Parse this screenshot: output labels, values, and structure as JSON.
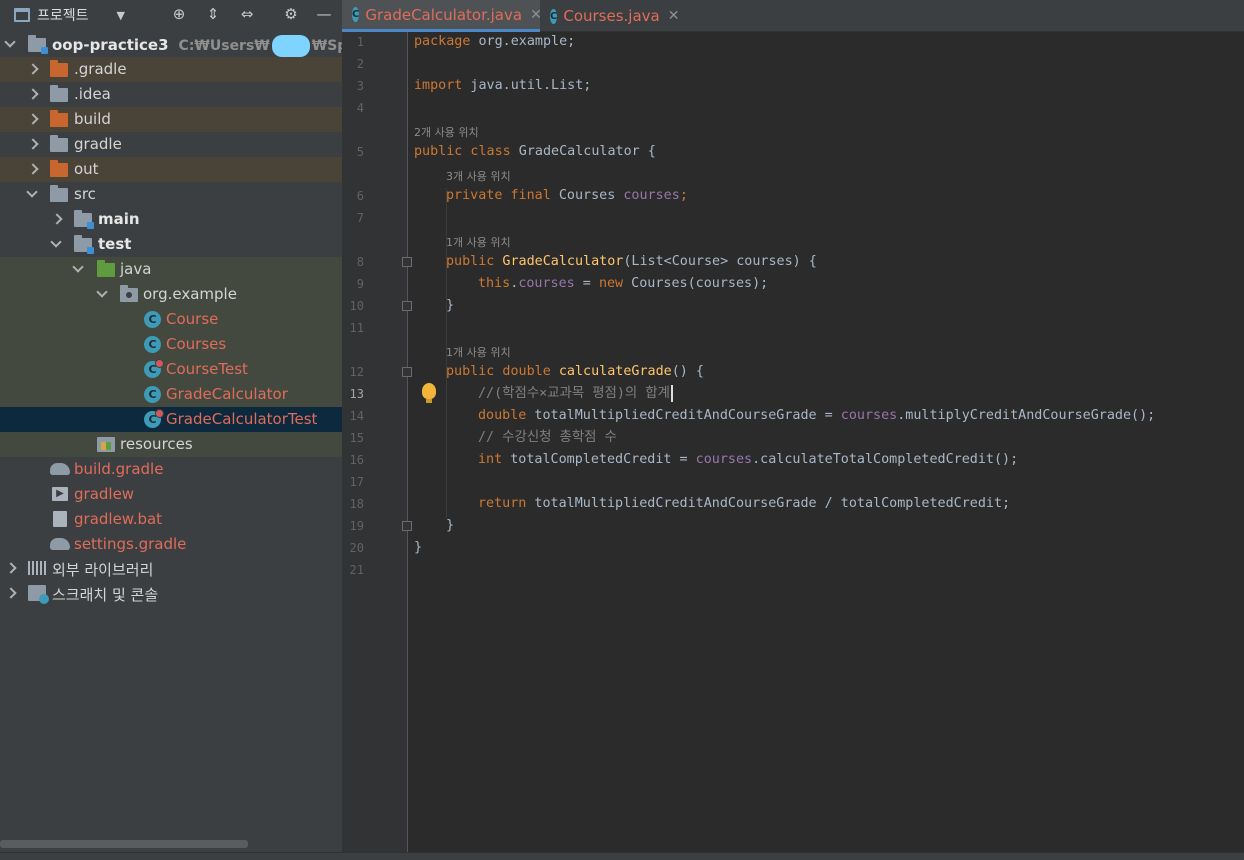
{
  "panel": {
    "title": "프로젝트",
    "dropdown": "▼",
    "toolbar": {
      "locate": "⊕",
      "expand": "⇕",
      "collapse": "⇔",
      "settings": "⚙",
      "hide": "—"
    }
  },
  "tree": {
    "root": {
      "label": "oop-practice3",
      "path_prefix": "C:₩Users₩",
      "path_suffix": "₩Spring_stu"
    },
    "items": [
      {
        "label": ".gradle"
      },
      {
        "label": ".idea"
      },
      {
        "label": "build"
      },
      {
        "label": "gradle"
      },
      {
        "label": "out"
      },
      {
        "label": "src"
      },
      {
        "label": "main"
      },
      {
        "label": "test"
      },
      {
        "label": "java"
      },
      {
        "label": "org.example"
      },
      {
        "label": "Course"
      },
      {
        "label": "Courses"
      },
      {
        "label": "CourseTest"
      },
      {
        "label": "GradeCalculator"
      },
      {
        "label": "GradeCalculatorTest"
      },
      {
        "label": "resources"
      },
      {
        "label": "build.gradle"
      },
      {
        "label": "gradlew"
      },
      {
        "label": "gradlew.bat"
      },
      {
        "label": "settings.gradle"
      },
      {
        "label": "외부 라이브러리"
      },
      {
        "label": "스크래치 및 콘솔"
      }
    ]
  },
  "tabs": [
    {
      "label": "GradeCalculator.java",
      "icon": "C",
      "close": "✕"
    },
    {
      "label": "Courses.java",
      "icon": "C",
      "close": "✕"
    }
  ],
  "icons": {
    "class": "C",
    "terminal": "▶"
  },
  "code": {
    "lines": [
      "1",
      "2",
      "3",
      "4",
      "5",
      "6",
      "7",
      "8",
      "9",
      "10",
      "11",
      "12",
      "13",
      "14",
      "15",
      "16",
      "17",
      "18",
      "19",
      "20",
      "21"
    ],
    "hints": {
      "h1": "2개 사용 위치",
      "h2": "3개 사용 위치",
      "h3": "1개 사용 위치",
      "h4": "1개 사용 위치"
    },
    "l1": {
      "kw": "package",
      "rest": " org.example;"
    },
    "l3": {
      "kw": "import",
      "rest": " java.util.List;"
    },
    "l5": {
      "kw": "public class",
      "rest": " GradeCalculator {"
    },
    "l6": {
      "kw": "private final",
      "type": " Courses ",
      "field": "courses",
      "end": ";"
    },
    "l8": {
      "kw": "public",
      "fn": " GradeCalculator",
      "rest": "(List<Course> courses) {"
    },
    "l9": {
      "kw": "this",
      "dot": ".",
      "field": "courses",
      "eq": " = ",
      "kw2": "new",
      "rest": " Courses(courses);"
    },
    "l10": {
      "text": "}"
    },
    "l12": {
      "kw": "public double",
      "fn": " calculateGrade",
      "rest": "() {"
    },
    "l13": {
      "comment": "//(학점수×교과목 평점)의 합계"
    },
    "l14": {
      "kw": "double",
      "rest": " totalMultipliedCreditAndCourseGrade = ",
      "field": "courses",
      "call": ".multiplyCreditAndCourseGrade();"
    },
    "l15": {
      "comment": "// 수강신청 총학점 수"
    },
    "l16": {
      "kw": "int",
      "rest": " totalCompletedCredit = ",
      "field": "courses",
      "call": ".calculateTotalCompletedCredit();"
    },
    "l18": {
      "kw": "return",
      "rest": " totalMultipliedCreditAndCourseGrade / totalCompletedCredit;"
    },
    "l19": {
      "text": "}"
    },
    "l20": {
      "text": "}"
    }
  }
}
